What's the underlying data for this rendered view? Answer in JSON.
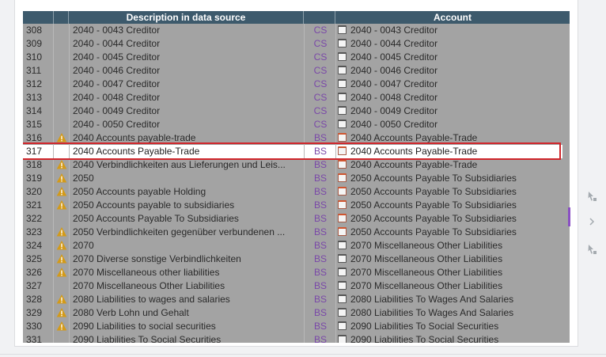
{
  "headers": {
    "num": "",
    "warn": "",
    "desc": "Description in data source",
    "type": "",
    "account": "Account"
  },
  "rows": [
    {
      "num": "308",
      "warn": false,
      "desc": "2040 - 0043 Creditor",
      "type": "CS",
      "account": "2040 - 0043 Creditor",
      "acc_red": false
    },
    {
      "num": "309",
      "warn": false,
      "desc": "2040 - 0044 Creditor",
      "type": "CS",
      "account": "2040 - 0044 Creditor",
      "acc_red": false
    },
    {
      "num": "310",
      "warn": false,
      "desc": "2040 - 0045 Creditor",
      "type": "CS",
      "account": "2040 - 0045 Creditor",
      "acc_red": false
    },
    {
      "num": "311",
      "warn": false,
      "desc": "2040 - 0046 Creditor",
      "type": "CS",
      "account": "2040 - 0046 Creditor",
      "acc_red": false
    },
    {
      "num": "312",
      "warn": false,
      "desc": "2040 - 0047 Creditor",
      "type": "CS",
      "account": "2040 - 0047 Creditor",
      "acc_red": false
    },
    {
      "num": "313",
      "warn": false,
      "desc": "2040 - 0048 Creditor",
      "type": "CS",
      "account": "2040 - 0048 Creditor",
      "acc_red": false
    },
    {
      "num": "314",
      "warn": false,
      "desc": "2040 - 0049 Creditor",
      "type": "CS",
      "account": "2040 - 0049 Creditor",
      "acc_red": false
    },
    {
      "num": "315",
      "warn": false,
      "desc": "2040 - 0050 Creditor",
      "type": "CS",
      "account": "2040 - 0050 Creditor",
      "acc_red": false
    },
    {
      "num": "316",
      "warn": true,
      "desc": "2040 Accounts payable-trade",
      "type": "BS",
      "account": "2040 Accounts Payable-Trade",
      "acc_red": true
    },
    {
      "num": "317",
      "warn": false,
      "desc": "2040 Accounts Payable-Trade",
      "type": "BS",
      "account": "2040 Accounts Payable-Trade",
      "acc_red": true,
      "selected": true
    },
    {
      "num": "318",
      "warn": true,
      "desc": "2040 Verbindlichkeiten aus Lieferungen und Leis...",
      "type": "BS",
      "account": "2040 Accounts Payable-Trade",
      "acc_red": true
    },
    {
      "num": "319",
      "warn": true,
      "desc": "2050",
      "type": "BS",
      "account": "2050 Accounts Payable To Subsidiaries",
      "acc_red": true
    },
    {
      "num": "320",
      "warn": true,
      "desc": "2050 Accounts payable Holding",
      "type": "BS",
      "account": "2050 Accounts Payable To Subsidiaries",
      "acc_red": true
    },
    {
      "num": "321",
      "warn": true,
      "desc": "2050 Accounts payable to subsidiaries",
      "type": "BS",
      "account": "2050 Accounts Payable To Subsidiaries",
      "acc_red": true
    },
    {
      "num": "322",
      "warn": false,
      "desc": "2050 Accounts Payable To Subsidiaries",
      "type": "BS",
      "account": "2050 Accounts Payable To Subsidiaries",
      "acc_red": true
    },
    {
      "num": "323",
      "warn": true,
      "desc": "2050 Verbindlichkeiten gegenüber verbundenen ...",
      "type": "BS",
      "account": "2050 Accounts Payable To Subsidiaries",
      "acc_red": true
    },
    {
      "num": "324",
      "warn": true,
      "desc": "2070",
      "type": "BS",
      "account": "2070 Miscellaneous Other Liabilities",
      "acc_red": false
    },
    {
      "num": "325",
      "warn": true,
      "desc": "2070 Diverse sonstige Verbindlichkeiten",
      "type": "BS",
      "account": "2070 Miscellaneous Other Liabilities",
      "acc_red": false
    },
    {
      "num": "326",
      "warn": true,
      "desc": "2070 Miscellaneous other liabilities",
      "type": "BS",
      "account": "2070 Miscellaneous Other Liabilities",
      "acc_red": false
    },
    {
      "num": "327",
      "warn": false,
      "desc": "2070 Miscellaneous Other Liabilities",
      "type": "BS",
      "account": "2070 Miscellaneous Other Liabilities",
      "acc_red": false
    },
    {
      "num": "328",
      "warn": true,
      "desc": "2080 Liabilities to wages and salaries",
      "type": "BS",
      "account": "2080 Liabilities To Wages And Salaries",
      "acc_red": false
    },
    {
      "num": "329",
      "warn": true,
      "desc": "2080 Verb Lohn und Gehalt",
      "type": "BS",
      "account": "2080 Liabilities To Wages And Salaries",
      "acc_red": false
    },
    {
      "num": "330",
      "warn": true,
      "desc": "2090 Liabilities to social securities",
      "type": "BS",
      "account": "2090 Liabilities To Social Securities",
      "acc_red": false
    },
    {
      "num": "331",
      "warn": false,
      "desc": "2090 Liabilities To Social Securities",
      "type": "BS",
      "account": "2090 Liabilities To Social Securities",
      "acc_red": false
    }
  ],
  "side_buttons": [
    "hand-pointer-icon",
    "chevron-right-icon",
    "hand-pointer-icon"
  ],
  "colors": {
    "header": "#3d5a6c",
    "type_text": "#7a48a8",
    "selection_border": "#d0262b",
    "accent_bar": "#8a4fc3"
  }
}
